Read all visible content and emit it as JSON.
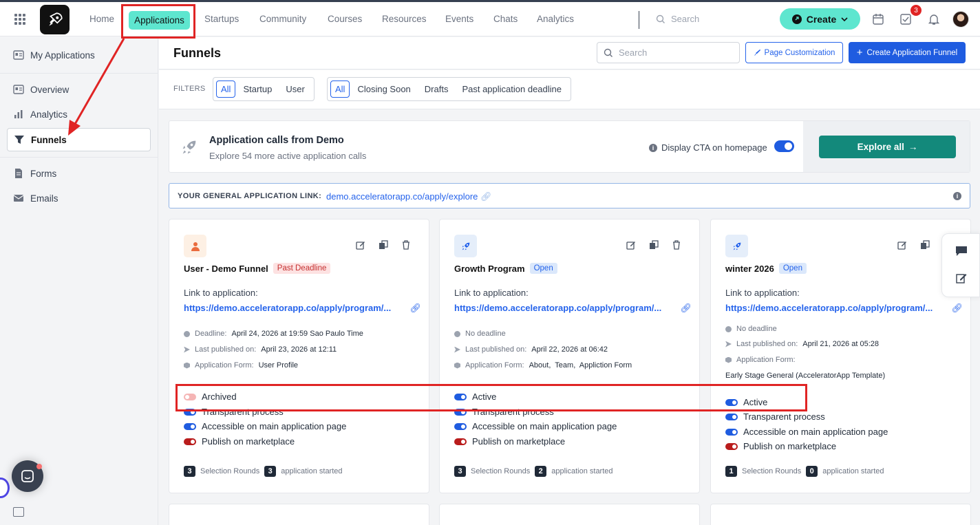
{
  "nav": {
    "items": [
      "Home",
      "Applications",
      "Startups",
      "Community",
      "Courses",
      "Resources",
      "Events",
      "Chats",
      "Analytics"
    ],
    "search_placeholder": "Search",
    "create_label": "Create",
    "task_badge": "3"
  },
  "sidebar": {
    "items": [
      "My Applications",
      "Overview",
      "Analytics",
      "Funnels",
      "Forms",
      "Emails"
    ],
    "active": "Funnels"
  },
  "header": {
    "title": "Funnels",
    "search_placeholder": "Search",
    "page_customization": "Page Customization",
    "create_funnel": "Create Application Funnel"
  },
  "filters": {
    "label": "FILTERS",
    "group1": [
      "All",
      "Startup",
      "User"
    ],
    "group2": [
      "All",
      "Closing Soon",
      "Drafts",
      "Past application deadline"
    ]
  },
  "promo": {
    "title": "Application calls from Demo",
    "subtitle": "Explore 54 more active application calls",
    "cta_label": "Display CTA on homepage",
    "explore": "Explore all"
  },
  "general_link": {
    "label": "YOUR GENERAL APPLICATION LINK:",
    "url": "demo.acceleratorapp.co/apply/explore"
  },
  "cards": [
    {
      "name": "User - Demo Funnel",
      "status": "Past Deadline",
      "link_label": "Link to application:",
      "url": "https://demo.acceleratorapp.co/apply/program/...",
      "deadline_label": "Deadline:",
      "deadline": "April 24, 2026 at 19:59 Sao Paulo Time",
      "published_label": "Last published on:",
      "published": "April 23, 2026 at 12:11",
      "form_label": "Application Form:",
      "form": "User Profile",
      "toggles": [
        "Archived",
        "Transparent process",
        "Accessible on main application page",
        "Publish on marketplace"
      ],
      "rounds": "3",
      "rounds_label": "Selection Rounds",
      "started": "3",
      "started_label": "application started"
    },
    {
      "name": "Growth Program",
      "status": "Open",
      "link_label": "Link to application:",
      "url": "https://demo.acceleratorapp.co/apply/program/...",
      "deadline": "No deadline",
      "published_label": "Last published on:",
      "published": "April 22, 2026 at 06:42",
      "form_label": "Application Form:",
      "form": "About,  Team,  Appliction Form",
      "toggles": [
        "Active",
        "Transparent process",
        "Accessible on main application page",
        "Publish on marketplace"
      ],
      "rounds": "3",
      "rounds_label": "Selection Rounds",
      "started": "2",
      "started_label": "application started"
    },
    {
      "name": "winter 2026",
      "status": "Open",
      "link_label": "Link to application:",
      "url": "https://demo.acceleratorapp.co/apply/program/...",
      "deadline": "No deadline",
      "published_label": "Last published on:",
      "published": "April 21, 2026 at 05:28",
      "form_label": "Application Form:",
      "form": "Early Stage General (AcceleratorApp Template)",
      "toggles": [
        "Active",
        "Transparent process",
        "Accessible on main application page",
        "Publish on marketplace"
      ],
      "rounds": "1",
      "rounds_label": "Selection Rounds",
      "started": "0",
      "started_label": "application started"
    }
  ],
  "colors": {
    "accent_teal": "#5ee6cf",
    "primary_blue": "#1f5ce0",
    "explore_green": "#13897b",
    "annotation_red": "#e02424"
  }
}
